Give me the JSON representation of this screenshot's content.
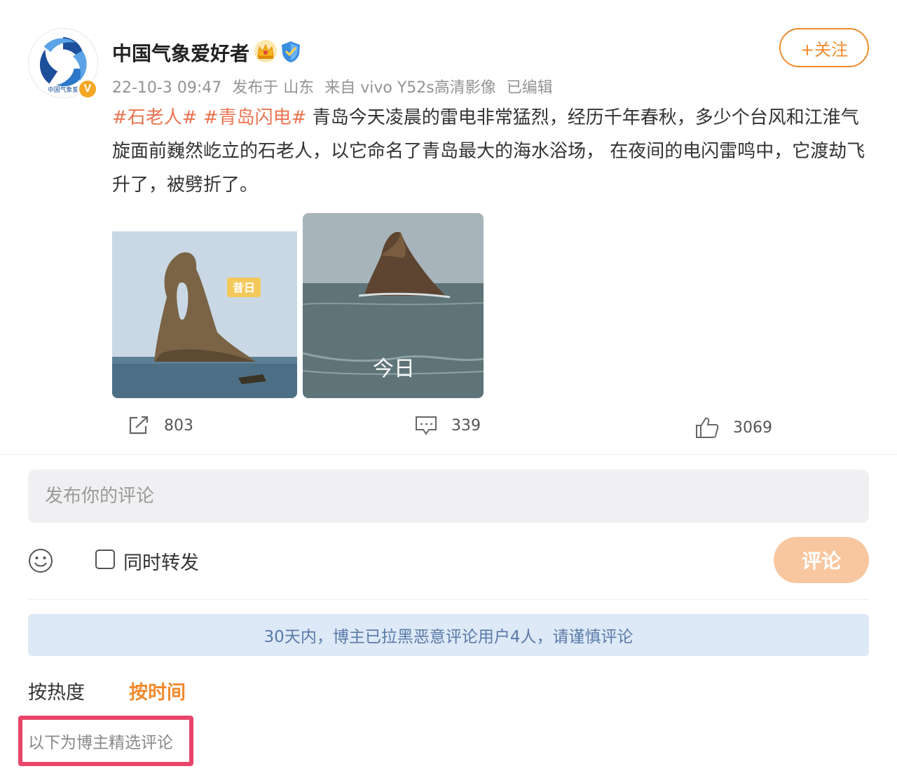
{
  "post": {
    "username": "中国气象爱好者",
    "follow_label": "+关注",
    "meta": {
      "time": "22-10-3 09:47",
      "location": "发布于 山东",
      "source": "来自 vivo Y52s高清影像",
      "edited": "已编辑"
    },
    "hashtags": [
      "#石老人#",
      "#青岛闪电#"
    ],
    "body": "青岛今天凌晨的雷电非常猛烈，经历千年春秋，多少个台风和江淮气旋面前巍然屹立的石老人，以它命名了青岛最大的海水浴场， 在夜间的电闪雷鸣中，它渡劫飞升了，被劈折了。",
    "avatar_text": "中国气象爱",
    "images": [
      {
        "caption": "昔日"
      },
      {
        "caption": "今日"
      }
    ]
  },
  "actions": {
    "repost_count": "803",
    "comment_count": "339",
    "like_count": "3069"
  },
  "compose": {
    "placeholder": "发布你的评论",
    "repost_label": "同时转发",
    "submit_label": "评论"
  },
  "notice": "30天内，博主已拉黑恶意评论用户4人，请谨慎评论",
  "sort": {
    "hot": "按热度",
    "time": "按时间"
  },
  "selected_label": "以下为博主精选评论",
  "colors": {
    "accent": "#f08a2e",
    "hashtag": "#eb7350",
    "notice_bg": "#dde9f7",
    "highlight_box": "#e8456a"
  }
}
